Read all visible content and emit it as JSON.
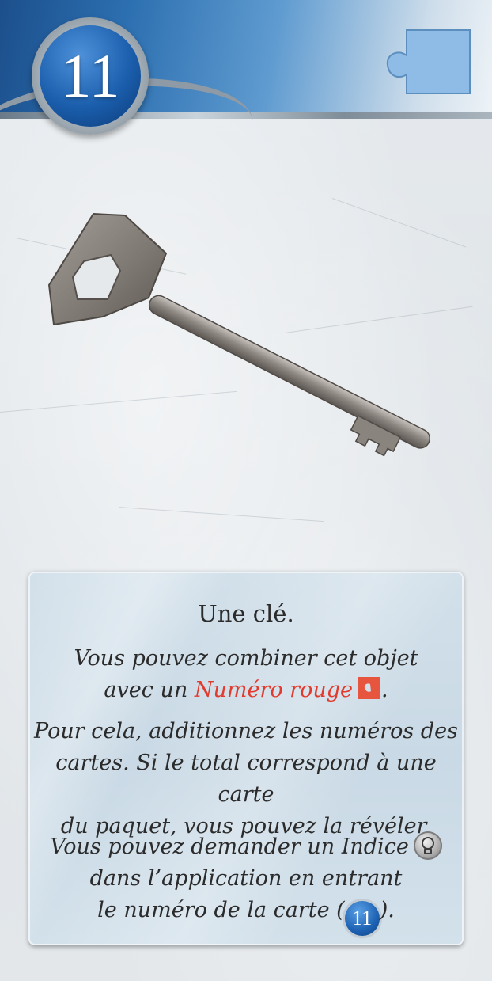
{
  "card": {
    "number": "11",
    "title": "Une clé.",
    "combine_prefix": "Vous pouvez combiner cet objet",
    "combine_line2_prefix": "avec un ",
    "combine_red": "Numéro rouge",
    "combine_suffix": ".",
    "rule_line1": "Pour cela, additionnez les numéros des",
    "rule_line2": "cartes. Si le total correspond à une carte",
    "rule_line3": "du paquet, vous pouvez la révéler.",
    "hint_line1": "Vous pouvez demander un Indice",
    "hint_line2": "dans l’application en entrant",
    "hint_line3_prefix": "le numéro de la carte (",
    "hint_line3_number": "11",
    "hint_line3_suffix": ")."
  },
  "icons": {
    "corner": "puzzle-piece-icon",
    "item": "key-icon",
    "red_number": "red-puzzle-icon",
    "hint": "lightbulb-icon",
    "card_number": "card-number-icon"
  },
  "colors": {
    "header_blue": "#1b5eac",
    "puzzle_blue": "#8fbce6",
    "red_number": "#e23a2c",
    "panel": "#cfdde8"
  }
}
